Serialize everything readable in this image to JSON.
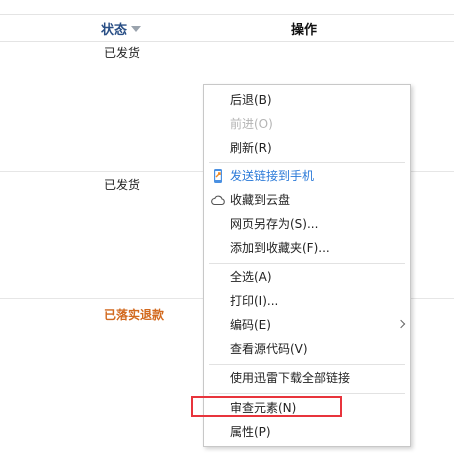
{
  "table": {
    "header": {
      "status": "状态",
      "action": "操作"
    },
    "rows": [
      {
        "status": "已发货"
      },
      {
        "status": "已发货"
      },
      {
        "status": "已落实退款"
      }
    ]
  },
  "context_menu": {
    "items": [
      {
        "label": "后退(B)",
        "state": "enabled"
      },
      {
        "label": "前进(O)",
        "state": "disabled"
      },
      {
        "label": "刷新(R)",
        "state": "enabled"
      },
      {
        "label": "发送链接到手机",
        "state": "enabled",
        "icon": "phone-send-icon",
        "color": "#2b7ad8"
      },
      {
        "label": "收藏到云盘",
        "state": "enabled",
        "icon": "cloud-icon"
      },
      {
        "label": "网页另存为(S)...",
        "state": "enabled"
      },
      {
        "label": "添加到收藏夹(F)...",
        "state": "enabled"
      },
      {
        "label": "全选(A)",
        "state": "enabled"
      },
      {
        "label": "打印(I)...",
        "state": "enabled"
      },
      {
        "label": "编码(E)",
        "state": "enabled",
        "submenu": true
      },
      {
        "label": "查看源代码(V)",
        "state": "enabled"
      },
      {
        "label": "使用迅雷下载全部链接",
        "state": "enabled"
      },
      {
        "label": "审查元素(N)",
        "state": "enabled",
        "highlighted": true
      },
      {
        "label": "属性(P)",
        "state": "enabled"
      }
    ]
  },
  "colors": {
    "header_status": "#2a4f86",
    "refund_status": "#d2691e",
    "highlight_box": "#e8343c",
    "link_blue": "#2b7ad8"
  }
}
